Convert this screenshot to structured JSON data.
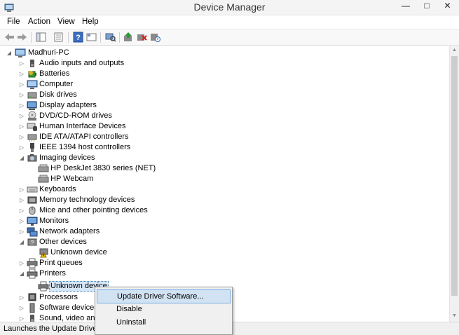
{
  "window": {
    "title": "Device Manager",
    "minimize_glyph": "—",
    "maximize_glyph": "□",
    "close_glyph": "✕"
  },
  "menu": [
    "File",
    "Action",
    "View",
    "Help"
  ],
  "toolbar": {
    "icons": [
      "back-icon",
      "forward-icon",
      "console-tree-icon",
      "properties-icon",
      "help-icon",
      "view-icon",
      "scan-hardware-icon",
      "update-driver-icon",
      "uninstall-icon",
      "disable-icon"
    ]
  },
  "tree": {
    "root": "Madhuri-PC",
    "items": [
      "Audio inputs and outputs",
      "Batteries",
      "Computer",
      "Disk drives",
      "Display adapters",
      "DVD/CD-ROM drives",
      "Human Interface Devices",
      "IDE ATA/ATAPI controllers",
      "IEEE 1394 host controllers",
      "Imaging devices",
      "HP DeskJet 3830 series (NET)",
      "HP Webcam",
      "Keyboards",
      "Memory technology devices",
      "Mice and other pointing devices",
      "Monitors",
      "Network adapters",
      "Other devices",
      "Unknown device",
      "Print queues",
      "Printers",
      "Unknown device",
      "Processors",
      "Software devices",
      "Sound, video and"
    ]
  },
  "context_menu": {
    "items": [
      "Update Driver Software...",
      "Disable",
      "Uninstall"
    ],
    "highlighted": "Update Driver Software..."
  },
  "status_bar": {
    "text": "Launches the Update Driver So"
  },
  "colors": {
    "selection": "#d5e6f7",
    "menu_highlight": "#d1e2f2",
    "accent": "#3c7fb1"
  }
}
